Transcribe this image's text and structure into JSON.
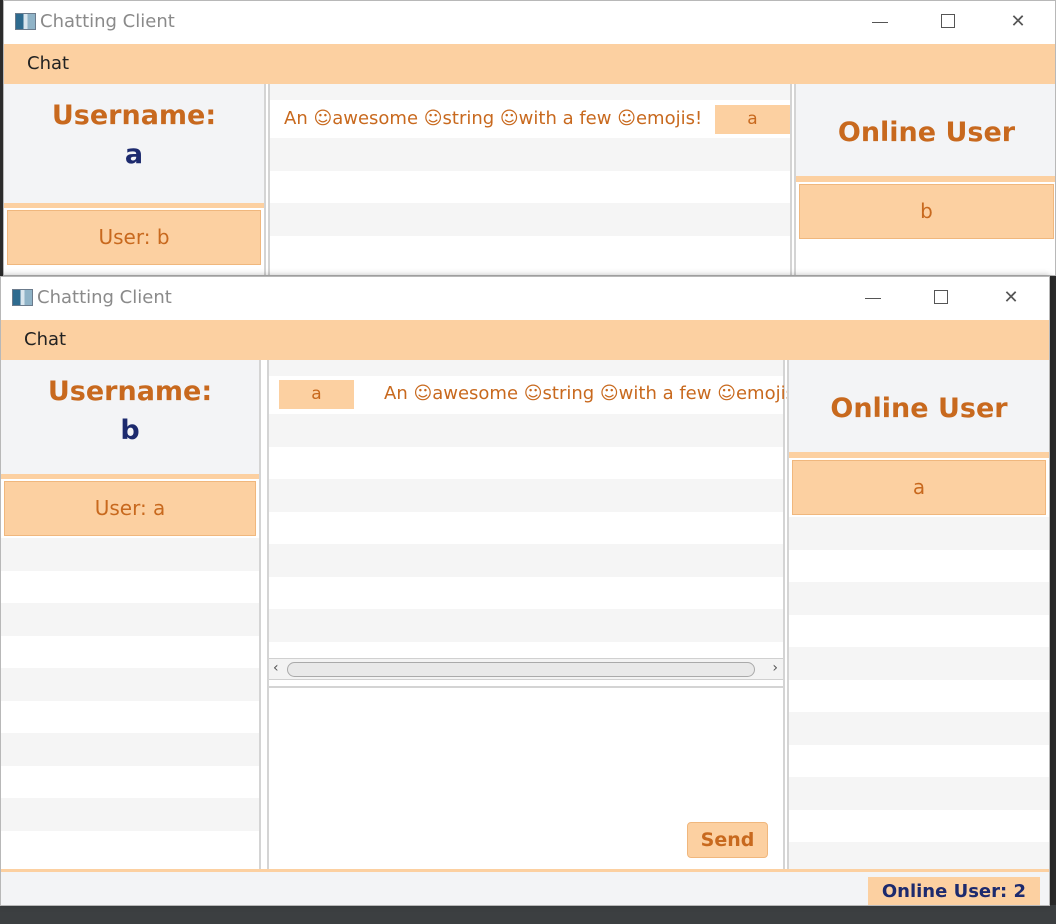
{
  "window_a": {
    "title": "Chatting Client",
    "menu": {
      "chat": "Chat"
    },
    "username_label": "Username:",
    "username_value": "a",
    "contacts": [
      "User: b"
    ],
    "messages": [
      {
        "text": "An ☺awesome ☺string ☺with a few ☺emojis!",
        "sender": "a",
        "side": "outgoing"
      }
    ],
    "online_header": "Online User",
    "online_users": [
      "b"
    ]
  },
  "window_b": {
    "title": "Chatting Client",
    "menu": {
      "chat": "Chat"
    },
    "username_label": "Username:",
    "username_value": "b",
    "contacts": [
      "User: a"
    ],
    "messages": [
      {
        "text": "An ☺awesome ☺string ☺with a few ☺emojis!",
        "sender": "a",
        "side": "incoming"
      }
    ],
    "send_label": "Send",
    "online_header": "Online User",
    "online_users": [
      "a"
    ],
    "status": "Online User: 2"
  },
  "colors": {
    "accent": "#fcd0a1",
    "accent_text": "#c8691e",
    "username_value": "#1c2a6e",
    "panel_bg": "#f3f4f6"
  }
}
